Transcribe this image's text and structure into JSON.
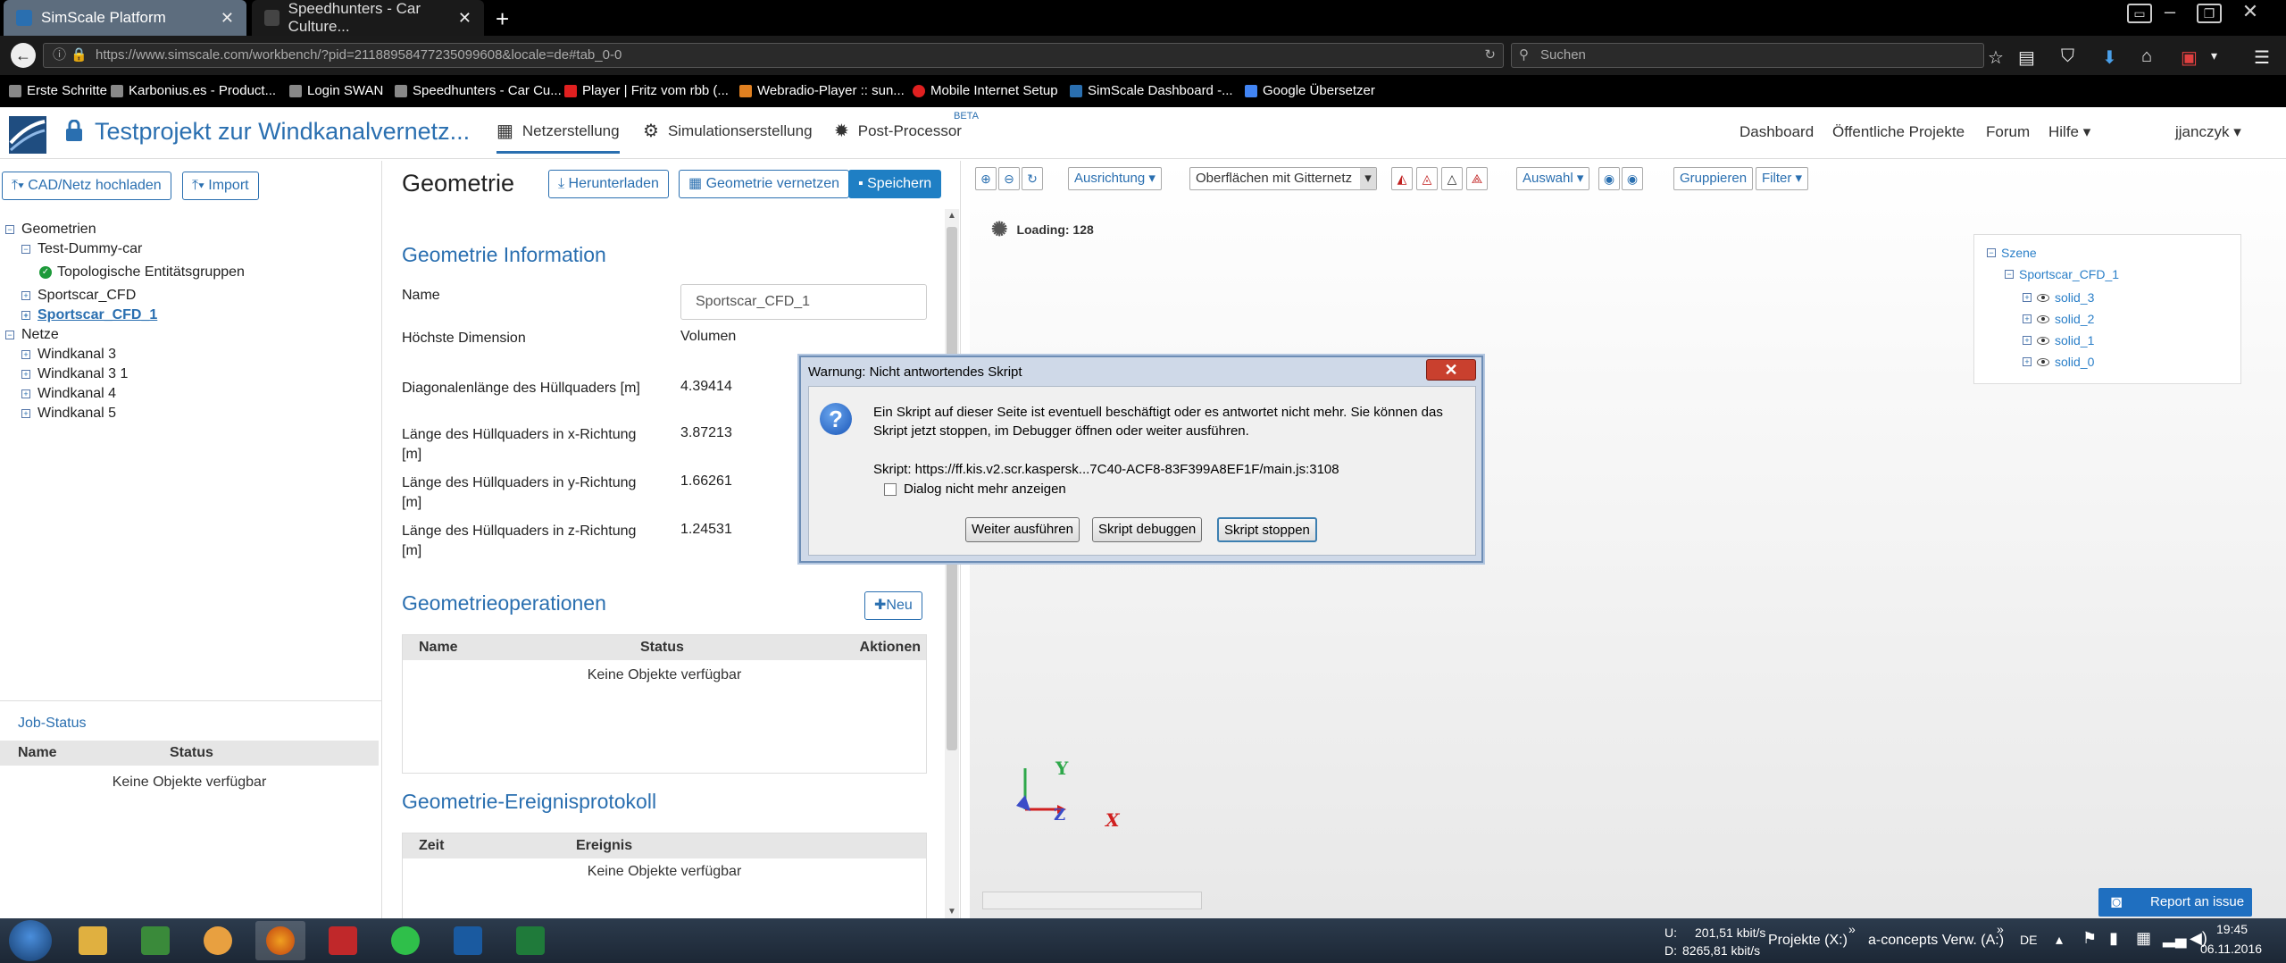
{
  "browser": {
    "tabs": [
      {
        "title": "SimScale Platform",
        "active": true
      },
      {
        "title": "Speedhunters - Car Culture...",
        "active": false
      }
    ],
    "url": "https://www.simscale.com/workbench/?pid=21188958477235099608&locale=de#tab_0-0",
    "search_placeholder": "Suchen",
    "bookmarks": [
      "Erste Schritte",
      "Karbonius.es - Product...",
      "Login SWAN",
      "Speedhunters - Car Cu...",
      "Player | Fritz vom rbb (...",
      "Webradio-Player :: sun...",
      "Mobile Internet Setup",
      "SimScale Dashboard -...",
      "Google Übersetzer"
    ]
  },
  "app": {
    "project_title": "Testprojekt zur Windkanalvernetz...",
    "tabs": [
      {
        "label": "Netzerstellung",
        "selected": true
      },
      {
        "label": "Simulationserstellung",
        "selected": false
      },
      {
        "label": "Post-Processor",
        "selected": false,
        "badge": "BETA"
      }
    ],
    "right_nav": {
      "dashboard": "Dashboard",
      "public": "Öffentliche Projekte",
      "forum": "Forum",
      "help": "Hilfe",
      "user": "jjanczyk"
    }
  },
  "left": {
    "upload_button": "CAD/Netz hochladen",
    "import_button": "Import",
    "tree": {
      "geometries": "Geometrien",
      "dummy": "Test-Dummy-car",
      "topo": "Topologische Entitätsgruppen",
      "sportscar_cfd": "Sportscar_CFD",
      "sportscar_cfd_1": "Sportscar_CFD_1",
      "meshes": "Netze",
      "mesh_items": [
        "Windkanal 3",
        "Windkanal 3 1",
        "Windkanal 4",
        "Windkanal 5"
      ]
    },
    "job_status": {
      "title": "Job-Status",
      "columns": [
        "Name",
        "Status"
      ],
      "empty": "Keine Objekte verfügbar"
    }
  },
  "center": {
    "title": "Geometrie",
    "download_button": "Herunterladen",
    "mesh_button": "Geometrie vernetzen",
    "save_button": "Speichern",
    "info_title": "Geometrie Information",
    "name_label": "Name",
    "name_value": "Sportscar_CFD_1",
    "rows": [
      {
        "label": "Höchste Dimension",
        "value": "Volumen"
      },
      {
        "label": "Diagonalenlänge des Hüllquaders [m]",
        "value": "4.39414"
      },
      {
        "label": "Länge des Hüllquaders in x-Richtung [m]",
        "value": "3.87213"
      },
      {
        "label": "Länge des Hüllquaders in y-Richtung [m]",
        "value": "1.66261"
      },
      {
        "label": "Länge des Hüllquaders in z-Richtung [m]",
        "value": "1.24531"
      }
    ],
    "ops_title": "Geometrieoperationen",
    "new_button": "Neu",
    "ops_columns": [
      "Name",
      "Status",
      "Aktionen"
    ],
    "ops_empty": "Keine Objekte verfügbar",
    "log_title": "Geometrie-Ereignisprotokoll",
    "log_columns": [
      "Zeit",
      "Ereignis"
    ],
    "log_empty": "Keine Objekte verfügbar"
  },
  "viewer": {
    "align_label": "Ausrichtung",
    "surface_select": "Oberflächen mit Gitternetz",
    "select_label": "Auswahl",
    "group_label": "Gruppieren",
    "filter_label": "Filter",
    "loading": "Loading: 128",
    "scene": {
      "root": "Szene",
      "model": "Sportscar_CFD_1",
      "solids": [
        "solid_3",
        "solid_2",
        "solid_1",
        "solid_0"
      ]
    },
    "axes": {
      "y": "Y",
      "z": "Z",
      "x": "X"
    },
    "report_issue": "Report an issue"
  },
  "dialog": {
    "title": "Warnung: Nicht antwortendes Skript",
    "message_line1": "Ein Skript auf dieser Seite ist eventuell beschäftigt oder es antwortet nicht mehr. Sie können das",
    "message_line2": "Skript jetzt stoppen, im Debugger öffnen oder weiter ausführen.",
    "script_line": "Skript: https://ff.kis.v2.scr.kaspersk...7C40-ACF8-83F399A8EF1F/main.js:3108",
    "checkbox_label": "Dialog nicht mehr anzeigen",
    "buttons": [
      "Weiter ausführen",
      "Skript debuggen",
      "Skript stoppen"
    ]
  },
  "taskbar": {
    "net_up_label": "U:",
    "net_up": "201,51 kbit/s",
    "net_down_label": "D:",
    "net_down": "8265,81 kbit/s",
    "drive1": "Projekte (X:)",
    "drive2": "a-concepts Verw. (A:)",
    "lang": "DE",
    "time": "19:45",
    "date": "06.11.2016"
  }
}
